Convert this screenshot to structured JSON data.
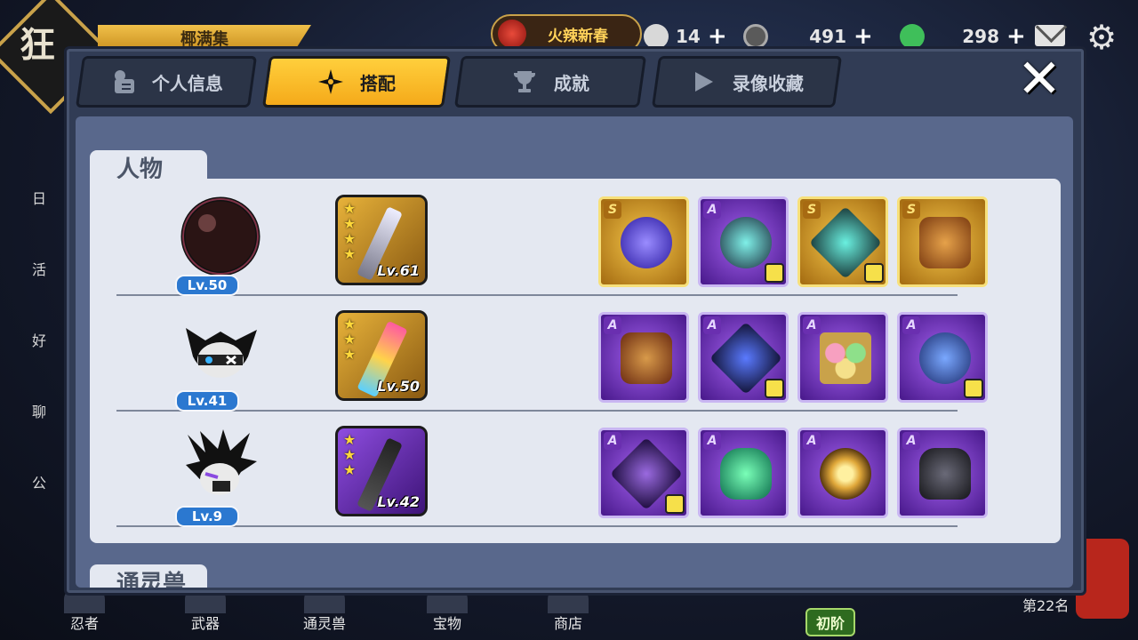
{
  "hud": {
    "logo_text": "狂",
    "player_name": "椰满集",
    "event_label": "火辣新春",
    "resources": [
      {
        "icon": "onigiri-icon",
        "value": "14",
        "color": "#d8d8d8"
      },
      {
        "icon": "coin-icon",
        "value": "491",
        "color": "#8a8a8a"
      },
      {
        "icon": "jade-icon",
        "value": "298",
        "color": "#3fbf5a"
      }
    ],
    "plus": "+"
  },
  "side_menu": [
    "日",
    "活",
    "好",
    "聊",
    "公"
  ],
  "bottom_nav": [
    "忍者",
    "武器",
    "通灵兽",
    "宝物",
    "商店"
  ],
  "rank_badge": "初阶",
  "level_text": "第22名",
  "dialog": {
    "tabs": [
      {
        "label": "个人信息",
        "icon": "profile-card-icon",
        "active": false
      },
      {
        "label": "搭配",
        "icon": "shuriken-icon",
        "active": true
      },
      {
        "label": "成就",
        "icon": "trophy-icon",
        "active": false
      },
      {
        "label": "录像收藏",
        "icon": "play-icon",
        "active": false
      }
    ],
    "close_label": "✕",
    "section_title": "人物",
    "section2_title": "通灵兽",
    "characters": [
      {
        "avatar": "bomb-ninja",
        "level": "Lv.50",
        "weapon": {
          "stars": 4,
          "level": "Lv.61",
          "rarity": "gold"
        },
        "items": [
          {
            "grade": "S",
            "name": "orb",
            "art_color": "#4a3ad0",
            "bonus": false
          },
          {
            "grade": "A",
            "name": "ring",
            "art_color": "#2bc6c0",
            "bonus": true
          },
          {
            "grade": "S",
            "name": "shuriken",
            "art_color": "#1a6a66",
            "bonus": true
          },
          {
            "grade": "S",
            "name": "armor",
            "art_color": "#c87a2a",
            "bonus": false
          }
        ]
      },
      {
        "avatar": "panda-ninja",
        "level": "Lv.41",
        "weapon": {
          "stars": 3,
          "level": "Lv.50",
          "rarity": "gold"
        },
        "items": [
          {
            "grade": "A",
            "name": "armor",
            "art_color": "#b0722a",
            "bonus": false
          },
          {
            "grade": "A",
            "name": "shuriken",
            "art_color": "#222244",
            "bonus": true
          },
          {
            "grade": "A",
            "name": "dango",
            "art_color": "#e2c36a",
            "bonus": false
          },
          {
            "grade": "A",
            "name": "ring",
            "art_color": "#2a4fd0",
            "bonus": true
          }
        ]
      },
      {
        "avatar": "wolf-ninja",
        "level": "Lv.9",
        "weapon": {
          "stars": 3,
          "level": "Lv.42",
          "rarity": "purple"
        },
        "items": [
          {
            "grade": "A",
            "name": "shuriken",
            "art_color": "#2a1a4a",
            "bonus": true
          },
          {
            "grade": "A",
            "name": "potion",
            "art_color": "#2bd68a",
            "bonus": false
          },
          {
            "grade": "A",
            "name": "medallion",
            "art_color": "#e0a83a",
            "bonus": false
          },
          {
            "grade": "A",
            "name": "chest-armor",
            "art_color": "#2c2c34",
            "bonus": false
          }
        ]
      }
    ]
  }
}
